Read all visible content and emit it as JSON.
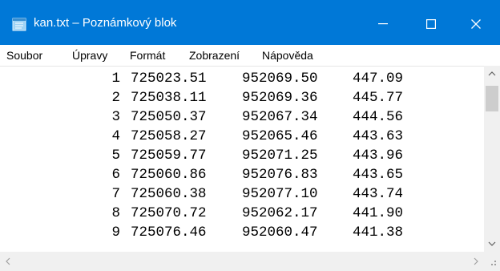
{
  "window": {
    "title": "kan.txt – Poznámkový blok",
    "accent_color": "#0078d7",
    "icons": [
      "notepad-icon",
      "minimize-icon",
      "maximize-icon",
      "close-icon"
    ]
  },
  "menu": [
    "Soubor",
    "Úpravy",
    "Formát",
    "Zobrazení",
    "Nápověda"
  ],
  "lines": [
    {
      "n": "1",
      "x": "725023.51",
      "y": "952069.50",
      "z": "447.09"
    },
    {
      "n": "2",
      "x": "725038.11",
      "y": "952069.36",
      "z": "445.77"
    },
    {
      "n": "3",
      "x": "725050.37",
      "y": "952067.34",
      "z": "444.56"
    },
    {
      "n": "4",
      "x": "725058.27",
      "y": "952065.46",
      "z": "443.63"
    },
    {
      "n": "5",
      "x": "725059.77",
      "y": "952071.25",
      "z": "443.96"
    },
    {
      "n": "6",
      "x": "725060.86",
      "y": "952076.83",
      "z": "443.65"
    },
    {
      "n": "7",
      "x": "725060.38",
      "y": "952077.10",
      "z": "443.74"
    },
    {
      "n": "8",
      "x": "725070.72",
      "y": "952062.17",
      "z": "441.90"
    },
    {
      "n": "9",
      "x": "725076.46",
      "y": "952060.47",
      "z": "441.38"
    }
  ]
}
